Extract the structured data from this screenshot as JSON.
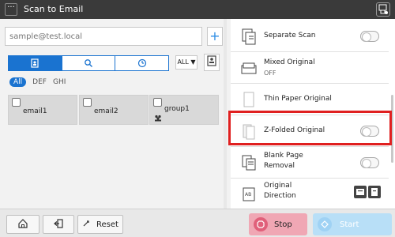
{
  "titlebar": {
    "menu_glyph": "···",
    "title": "Scan to Email",
    "right_icon": "device-status-icon"
  },
  "address": {
    "placeholder": "sample@test.local",
    "add_label": "+"
  },
  "search_tabs": [
    {
      "icon": "address-book-icon",
      "active": true
    },
    {
      "icon": "search-icon",
      "active": false
    },
    {
      "icon": "history-clock-icon",
      "active": false
    }
  ],
  "sort": {
    "label": "ALL ▼"
  },
  "filters": [
    "All",
    "DEF",
    "GHI"
  ],
  "destinations": [
    {
      "label": "email1",
      "type": "email"
    },
    {
      "label": "email2",
      "type": "email"
    },
    {
      "label": "group1",
      "type": "group",
      "type_icon": "group-icon"
    }
  ],
  "options": [
    {
      "label": "Separate Scan",
      "sub": "",
      "toggle": false
    },
    {
      "label": "Mixed Original",
      "sub": "OFF",
      "toggle": null
    },
    {
      "label": "Thin Paper Original",
      "sub": "",
      "toggle": false
    },
    {
      "label": "Z-Folded Original",
      "sub": "",
      "toggle": false,
      "highlighted": true
    },
    {
      "label": "Blank Page",
      "label2": "Removal",
      "toggle": false
    },
    {
      "label": "Original",
      "label2": "Direction",
      "toggle": null
    }
  ],
  "bottom": {
    "home_icon": "home-icon",
    "logout_icon": "logout-icon",
    "reset_label": "Reset",
    "stop_label": "Stop",
    "start_label": "Start"
  },
  "colors": {
    "accent": "#1a73d0",
    "highlight": "#e02020",
    "stop": "#f0a7b4",
    "start": "#b8dff7"
  }
}
